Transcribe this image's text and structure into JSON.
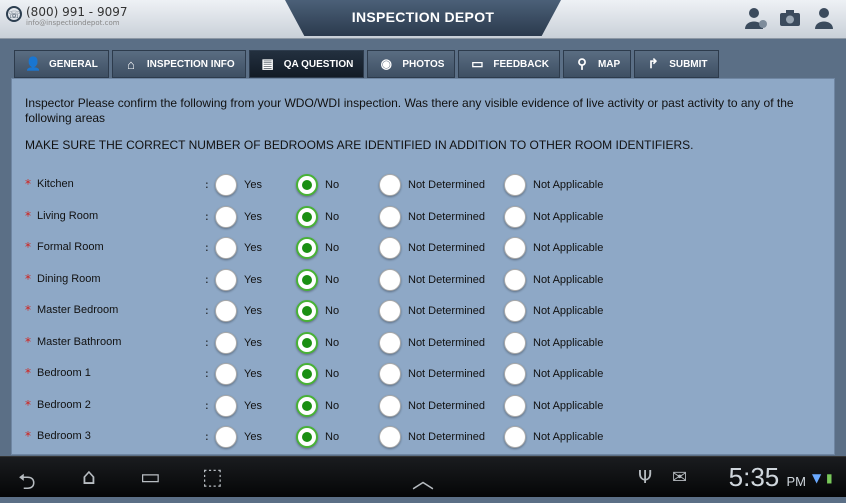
{
  "header": {
    "phone": "(800) 991 - 9097",
    "email": "info@inspectiondepot.com",
    "title": "INSPECTION DEPOT"
  },
  "tabs": [
    {
      "label": "GENERAL",
      "icon": "user-icon",
      "active": false
    },
    {
      "label": "INSPECTION INFO",
      "icon": "home-icon",
      "active": false
    },
    {
      "label": "QA QUESTION",
      "icon": "document-icon",
      "active": true
    },
    {
      "label": "PHOTOS",
      "icon": "camera-icon",
      "active": false
    },
    {
      "label": "FEEDBACK",
      "icon": "chat-icon",
      "active": false
    },
    {
      "label": "MAP",
      "icon": "location-pin-icon",
      "active": false
    },
    {
      "label": "SUBMIT",
      "icon": "share-arrow-icon",
      "active": false
    }
  ],
  "question": {
    "intro": "Inspector Please confirm the following from your WDO/WDI inspection. Was there any visible evidence of live activity or past activity to any of the following areas",
    "warning": "MAKE SURE THE CORRECT NUMBER OF BEDROOMS ARE IDENTIFIED IN ADDITION TO OTHER ROOM IDENTIFIERS."
  },
  "option_labels": [
    "Yes",
    "No",
    "Not Determined",
    "Not Applicable"
  ],
  "rows": [
    {
      "label": "Kitchen",
      "selected": "No"
    },
    {
      "label": "Living Room",
      "selected": "No"
    },
    {
      "label": "Formal Room",
      "selected": "No"
    },
    {
      "label": "Dining Room",
      "selected": "No"
    },
    {
      "label": "Master Bedroom",
      "selected": "No"
    },
    {
      "label": "Master Bathroom",
      "selected": "No"
    },
    {
      "label": "Bedroom 1",
      "selected": "No"
    },
    {
      "label": "Bedroom 2",
      "selected": "No"
    },
    {
      "label": "Bedroom 3",
      "selected": "No"
    }
  ],
  "status_bar": {
    "time": "5:35",
    "ampm": "PM"
  },
  "colors": {
    "accent_selected": "#1a8f12",
    "required_star": "#d2201b",
    "panel_bg": "#8ea8c6"
  }
}
